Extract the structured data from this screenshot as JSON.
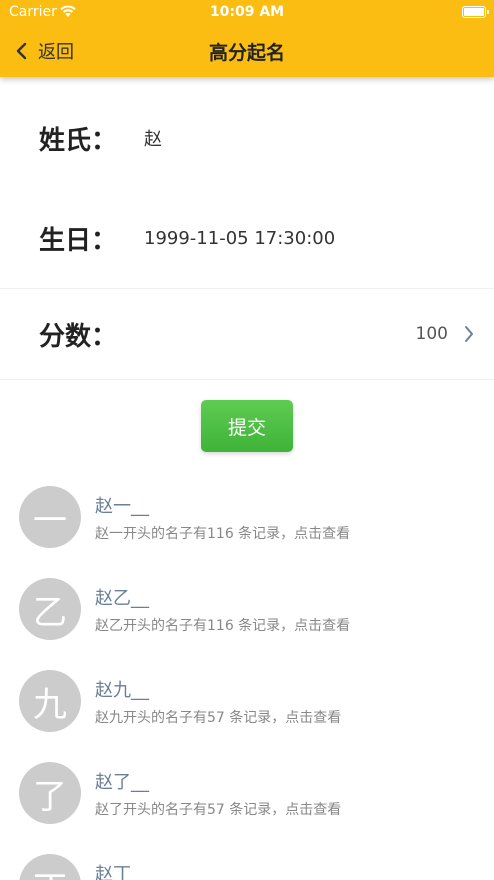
{
  "status_bar": {
    "carrier": "Carrier",
    "time": "10:09 AM"
  },
  "nav": {
    "back_label": "返回",
    "title": "高分起名"
  },
  "form": {
    "surname": {
      "label": "姓氏：",
      "value": "赵"
    },
    "birthday": {
      "label": "生日：",
      "value": "1999-11-05 17:30:00"
    },
    "score": {
      "label": "分数：",
      "value": "100"
    }
  },
  "submit_label": "提交",
  "list": [
    {
      "avatar": "一",
      "title": "赵一__",
      "subtitle": "赵一开头的名子有116 条记录，点击查看"
    },
    {
      "avatar": "乙",
      "title": "赵乙__",
      "subtitle": "赵乙开头的名子有116 条记录，点击查看"
    },
    {
      "avatar": "九",
      "title": "赵九__",
      "subtitle": "赵九开头的名子有57 条记录，点击查看"
    },
    {
      "avatar": "了",
      "title": "赵了__",
      "subtitle": "赵了开头的名子有57 条记录，点击查看"
    },
    {
      "avatar": "丁",
      "title": "赵丁__",
      "subtitle": ""
    }
  ],
  "colors": {
    "header": "#fbbd12",
    "submit": "#4cbf45",
    "avatar": "#cccccc",
    "item_title": "#6b7f96"
  }
}
